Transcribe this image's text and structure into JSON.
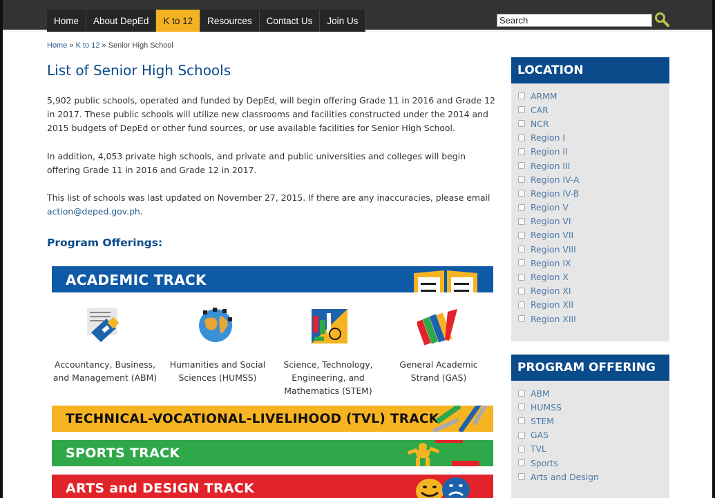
{
  "nav": {
    "items": [
      {
        "label": "Home",
        "active": false
      },
      {
        "label": "About DepEd",
        "active": false
      },
      {
        "label": "K to 12",
        "active": true
      },
      {
        "label": "Resources",
        "active": false
      },
      {
        "label": "Contact Us",
        "active": false
      },
      {
        "label": "Join Us",
        "active": false
      }
    ],
    "search_value": "Search",
    "search_icon": "search-icon"
  },
  "breadcrumb": {
    "home": "Home",
    "sep": "»",
    "k12": "K to 12",
    "current": "Senior High School"
  },
  "main": {
    "title": "List of Senior High Schools",
    "p1": "5,902 public schools, operated and funded by DepEd, will begin offering Grade 11 in 2016 and Grade 12 in 2017. These public schools will utilize new classrooms and facilities constructed under the 2014 and 2015 budgets of DepEd or other fund sources, or use available facilities for Senior High School.",
    "p2": "In addition, 4,053 private high schools, and private and public universities and colleges will begin offering Grade 11 in 2016 and Grade 12 in 2017.",
    "p3_prefix": "This list of schools was last updated on November 27, 2015. If there are any inaccuracies, please email ",
    "p3_email": "action@deped.gov.ph",
    "p3_suffix": ".",
    "offerings_title": "Program Offerings:"
  },
  "tracks": {
    "academic": "ACADEMIC TRACK",
    "tvl": "TECHNICAL-VOCATIONAL-LIVELIHOOD (TVL) TRACK",
    "sports": "SPORTS TRACK",
    "arts": "ARTS and DESIGN TRACK"
  },
  "strands": [
    {
      "label": "Accountancy, Business, and Management (ABM)",
      "icon": "abm-icon"
    },
    {
      "label": "Humanities and Social Sciences (HUMSS)",
      "icon": "globe-icon"
    },
    {
      "label": "Science, Technology, Engineering, and Mathematics (STEM)",
      "icon": "stem-icon"
    },
    {
      "label": "General Academic Strand (GAS)",
      "icon": "books-icon"
    }
  ],
  "sidebar": {
    "location": {
      "title": "LOCATION",
      "items": [
        "ARMM",
        "CAR",
        "NCR",
        "Region I",
        "Region II",
        "Region III",
        "Region IV-A",
        "Region IV-B",
        "Region V",
        "Region VI",
        "Region VII",
        "Region VIII",
        "Region IX",
        "Region X",
        "Region XI",
        "Region XII",
        "Region XIII"
      ]
    },
    "program": {
      "title": "PROGRAM OFFERING",
      "items": [
        "ABM",
        "HUMSS",
        "STEM",
        "GAS",
        "TVL",
        "Sports",
        "Arts and Design"
      ]
    }
  },
  "colors": {
    "nav_bg": "#333333",
    "nav_active": "#f4b223",
    "brand_blue": "#0b4b8c",
    "academic": "#0e5aa7",
    "tvl": "#f7b422",
    "sports": "#2ea849",
    "arts": "#e2232a"
  }
}
